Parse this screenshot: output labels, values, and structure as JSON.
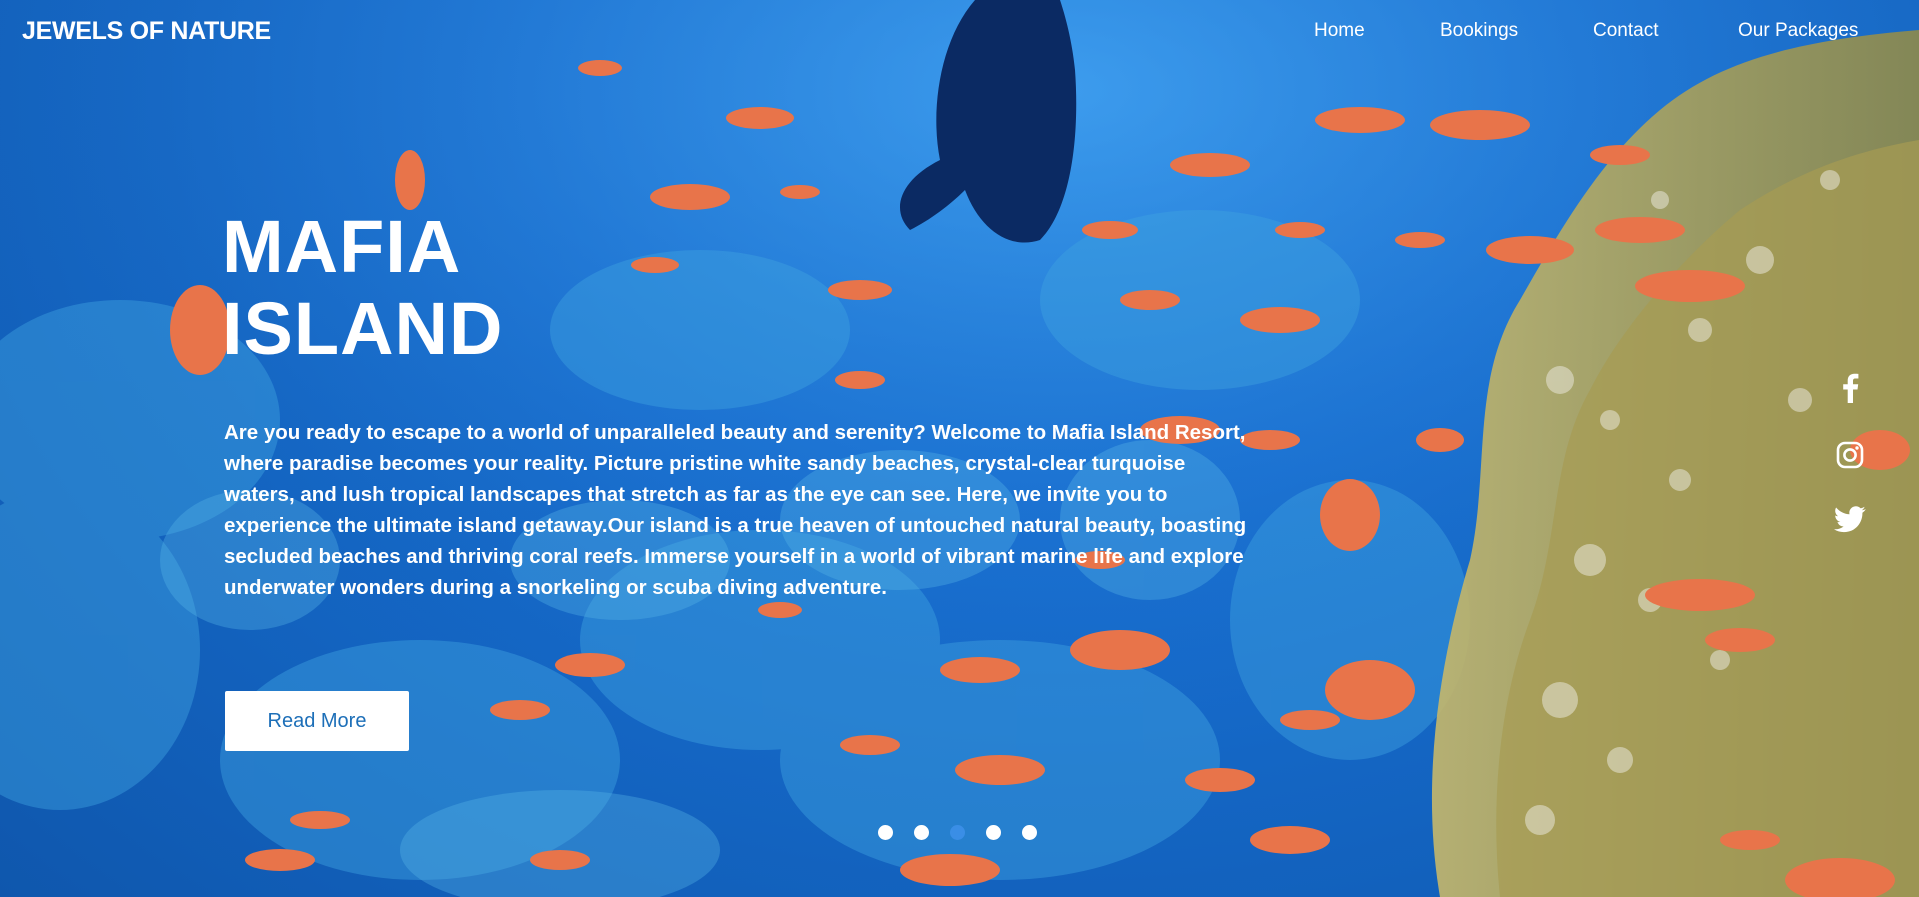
{
  "brand": {
    "logo": "JEWELS OF NATURE"
  },
  "nav": {
    "items": [
      {
        "label": "Home"
      },
      {
        "label": "Bookings"
      },
      {
        "label": "Contact"
      },
      {
        "label": "Our Packages"
      }
    ]
  },
  "hero": {
    "title_line1": "MAFIA",
    "title_line2": "ISLAND",
    "description": "Are you ready to escape to a world of unparalleled beauty and serenity? Welcome to Mafia Island Resort, where paradise becomes your reality. Picture pristine white sandy beaches, crystal-clear turquoise waters, and lush tropical landscapes that stretch as far as the eye can see. Here, we invite you to experience the ultimate island getaway.Our island is a true heaven of untouched natural beauty, boasting secluded beaches and thriving coral reefs. Immerse yourself in a world of vibrant marine life and explore underwater wonders during a snorkeling or scuba diving adventure.",
    "cta_label": "Read More"
  },
  "social": [
    {
      "icon": "facebook-icon"
    },
    {
      "icon": "instagram-icon"
    },
    {
      "icon": "twitter-icon"
    }
  ],
  "carousel": {
    "slides": 5,
    "active_index": 2
  },
  "colors": {
    "background": "#1a73d6",
    "text": "#ffffff",
    "button_text": "#1d6fb8",
    "active_dot": "#3a8ee6"
  }
}
